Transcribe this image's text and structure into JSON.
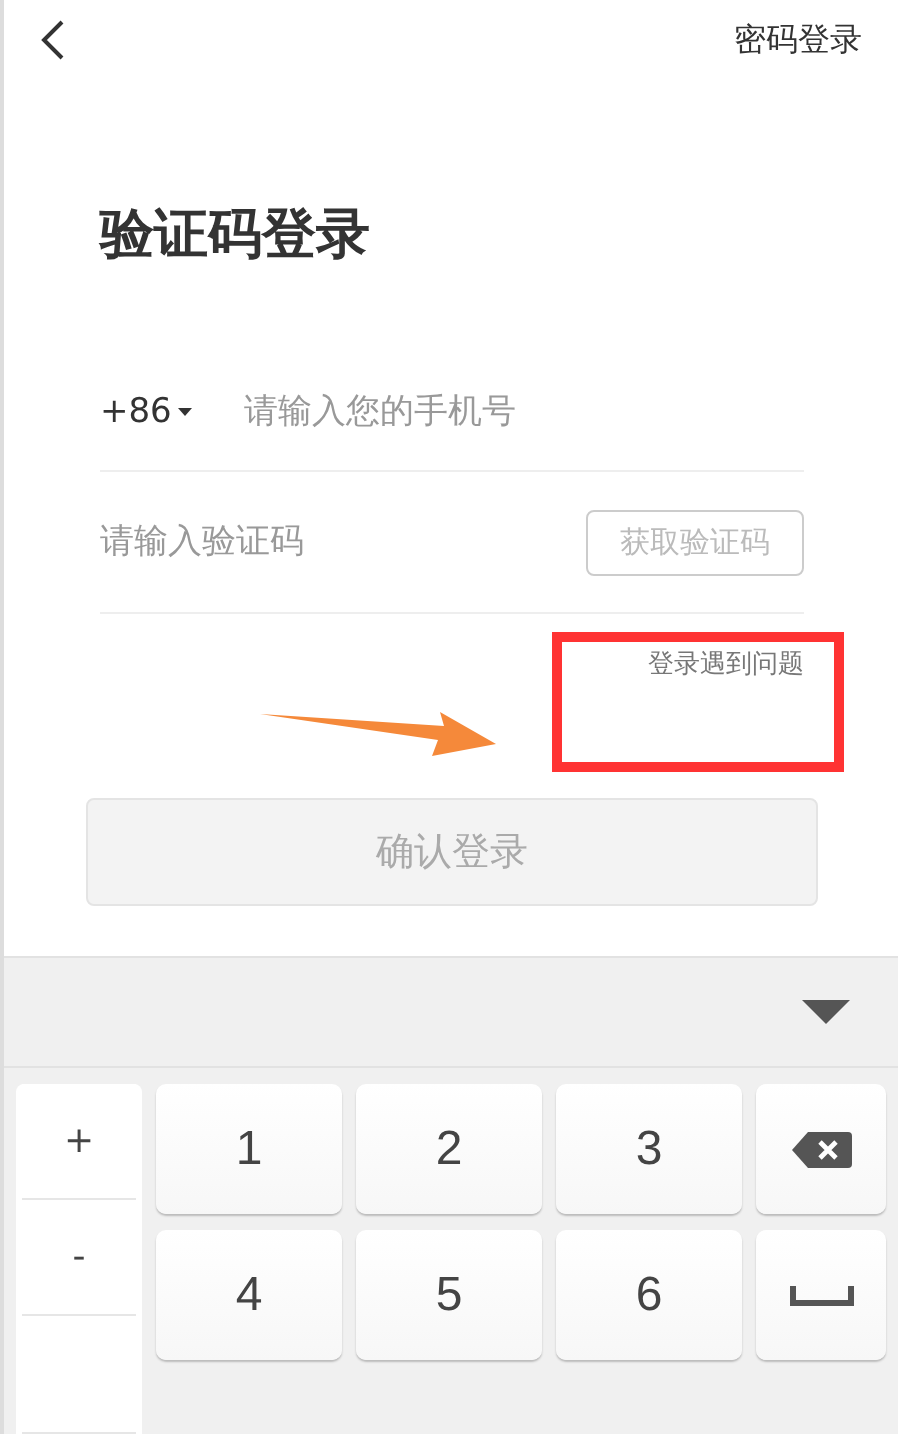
{
  "top_bar": {
    "right_link": "密码登录"
  },
  "title": "验证码登录",
  "phone": {
    "country_code": "+86",
    "placeholder": "请输入您的手机号"
  },
  "code": {
    "placeholder": "请输入验证码",
    "button": {
      "label": "获取验证码",
      "disabled": true
    }
  },
  "help_link": "登录遇到问题",
  "confirm_button": {
    "label": "确认登录",
    "disabled": true
  },
  "keyboard": {
    "side_keys": [
      "+",
      "-"
    ],
    "rows": [
      [
        {
          "kind": "char",
          "label": "1"
        },
        {
          "kind": "char",
          "label": "2"
        },
        {
          "kind": "char",
          "label": "3"
        },
        {
          "kind": "backspace"
        }
      ],
      [
        {
          "kind": "char",
          "label": "4"
        },
        {
          "kind": "char",
          "label": "5"
        },
        {
          "kind": "char",
          "label": "6"
        },
        {
          "kind": "space"
        }
      ]
    ]
  }
}
